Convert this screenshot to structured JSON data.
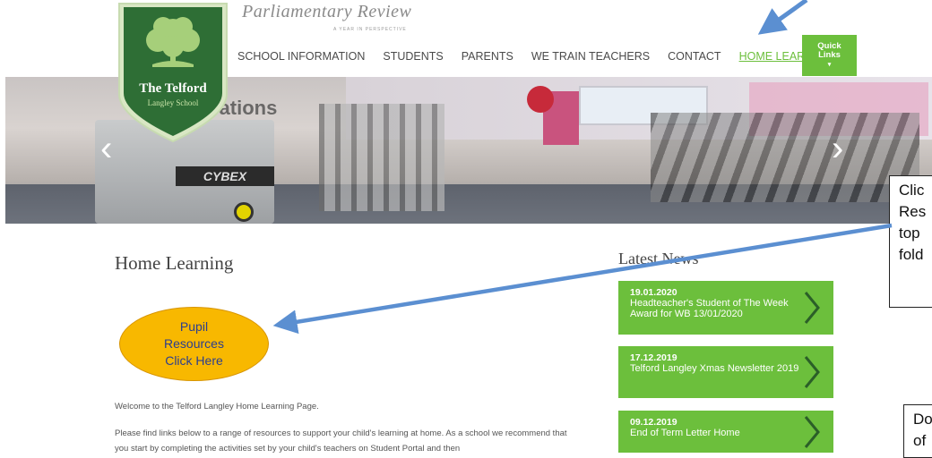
{
  "brand": {
    "name": "Parliamentary Review",
    "tagline": "A YEAR IN PERSPECTIVE"
  },
  "logo": {
    "line1": "The Telford",
    "line2": "Langley School"
  },
  "nav": {
    "items": [
      "SCHOOL INFORMATION",
      "STUDENTS",
      "PARENTS",
      "WE TRAIN TEACHERS",
      "CONTACT",
      "HOME LEARNING"
    ],
    "active": "HOME LEARNING"
  },
  "quick_links": {
    "line1": "Quick",
    "line2": "Links",
    "chevron": "▾"
  },
  "hero": {
    "prev_glyph": "‹",
    "next_glyph": "›",
    "plate_text": "CYBEX",
    "wall_text": "rations"
  },
  "main": {
    "title": "Home Learning",
    "pupil_button": {
      "line1": "Pupil",
      "line2": "Resources",
      "line3": "Click Here"
    },
    "welcome": "Welcome to the Telford Langley Home Learning Page.",
    "paragraph": "Please find links below to a range of resources to support your child's learning at home. As a school we recommend that you start by completing the activities set by your child's teachers on Student Portal and then"
  },
  "news": {
    "title": "Latest News",
    "items": [
      {
        "date": "19.01.2020",
        "text": "Headteacher's Student of The Week Award for WB 13/01/2020"
      },
      {
        "date": "17.12.2019",
        "text": "Telford Langley Xmas Newsletter 2019"
      },
      {
        "date": "09.12.2019",
        "text": "End of Term Letter Home"
      }
    ]
  },
  "callouts": {
    "right_top": [
      "Clic",
      "Res",
      "top",
      "fold"
    ],
    "right_bottom": [
      "Do",
      "of"
    ]
  },
  "colors": {
    "accent_green": "#6cbf3c",
    "arrow_blue": "#5b8fd1",
    "button_yellow": "#f8b800",
    "logo_green": "#2e6e35"
  }
}
